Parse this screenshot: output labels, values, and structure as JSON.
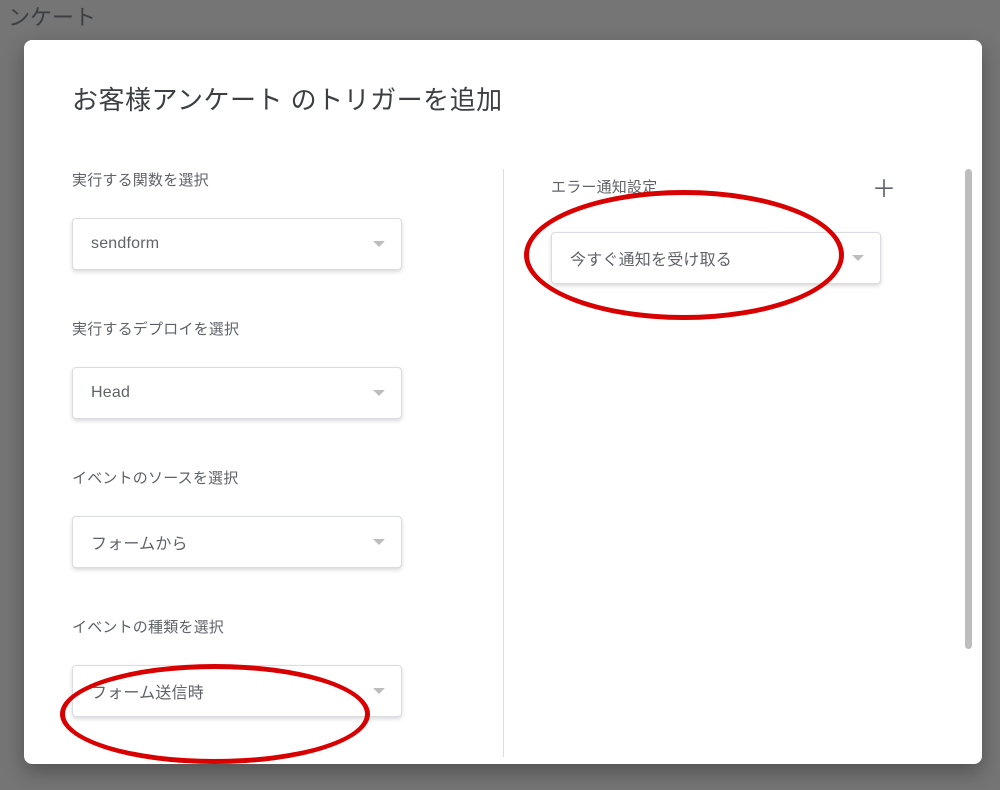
{
  "backdrop": {
    "titleFragment": "ンケート"
  },
  "modal": {
    "title": "お客様アンケート のトリガーを追加"
  },
  "left": {
    "functionLabel": "実行する関数を選択",
    "functionValue": "sendform",
    "deployLabel": "実行するデプロイを選択",
    "deployValue": "Head",
    "eventSourceLabel": "イベントのソースを選択",
    "eventSourceValue": "フォームから",
    "eventTypeLabel": "イベントの種類を選択",
    "eventTypeValue": "フォーム送信時"
  },
  "right": {
    "errorLabel": "エラー通知設定",
    "errorValue": "今すぐ通知を受け取る"
  }
}
